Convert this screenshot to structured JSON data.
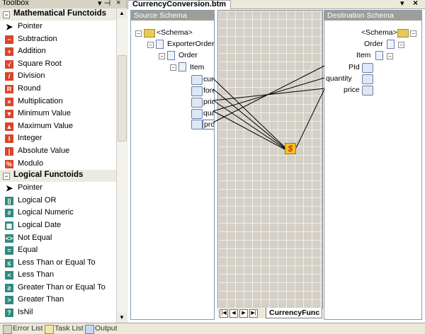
{
  "toolbox": {
    "title": "Toolbox",
    "controls": {
      "pin": "▾ ⊣",
      "close": "×"
    },
    "categories": [
      {
        "label": "Mathematical Functoids",
        "expander": "−",
        "items": [
          {
            "label": "Pointer",
            "icon": "pointer-icon",
            "glyph": "➤"
          },
          {
            "label": "Subtraction",
            "icon": "subtraction-icon",
            "glyph": "−"
          },
          {
            "label": "Addition",
            "icon": "addition-icon",
            "glyph": "+"
          },
          {
            "label": "Square Root",
            "icon": "square-root-icon",
            "glyph": "√"
          },
          {
            "label": "Division",
            "icon": "division-icon",
            "glyph": "/"
          },
          {
            "label": "Round",
            "icon": "round-icon",
            "glyph": "R"
          },
          {
            "label": "Multiplication",
            "icon": "multiplication-icon",
            "glyph": "×"
          },
          {
            "label": "Minimum Value",
            "icon": "minimum-value-icon",
            "glyph": "▼"
          },
          {
            "label": "Maximum Value",
            "icon": "maximum-value-icon",
            "glyph": "▲"
          },
          {
            "label": "Integer",
            "icon": "integer-icon",
            "glyph": "I"
          },
          {
            "label": "Absolute Value",
            "icon": "absolute-value-icon",
            "glyph": "|"
          },
          {
            "label": "Modulo",
            "icon": "modulo-icon",
            "glyph": "%"
          }
        ]
      },
      {
        "label": "Logical Functoids",
        "expander": "−",
        "items": [
          {
            "label": "Pointer",
            "icon": "pointer-icon",
            "glyph": "➤"
          },
          {
            "label": "Logical OR",
            "icon": "logical-or-icon",
            "glyph": "||"
          },
          {
            "label": "Logical Numeric",
            "icon": "logical-numeric-icon",
            "glyph": "#"
          },
          {
            "label": "Logical Date",
            "icon": "logical-date-icon",
            "glyph": "▦"
          },
          {
            "label": "Not Equal",
            "icon": "not-equal-icon",
            "glyph": "<>"
          },
          {
            "label": "Equal",
            "icon": "equal-icon",
            "glyph": "="
          },
          {
            "label": "Less Than or Equal To",
            "icon": "less-than-or-equal-icon",
            "glyph": "≤"
          },
          {
            "label": "Less Than",
            "icon": "less-than-icon",
            "glyph": "<"
          },
          {
            "label": "Greater Than or Equal To",
            "icon": "greater-than-or-equal-icon",
            "glyph": "≥"
          },
          {
            "label": "Greater Than",
            "icon": "greater-than-icon",
            "glyph": ">"
          },
          {
            "label": "IsNil",
            "icon": "isnil-icon",
            "glyph": "?"
          }
        ]
      }
    ]
  },
  "bottom_tabs": [
    {
      "label": "Error List",
      "icon": "error-list-icon"
    },
    {
      "label": "Task List",
      "icon": "task-list-icon"
    },
    {
      "label": "Output",
      "icon": "output-icon"
    }
  ],
  "document": {
    "tab_title": "CurrencyConversion.btm",
    "controls": {
      "dropdown": "▾",
      "close": "×"
    },
    "source": {
      "header": "Source Schema",
      "nodes": [
        "<Schema>",
        "ExporterOrder",
        "Order",
        "Item",
        "cur",
        "fore",
        "pric",
        "qua",
        "pro"
      ]
    },
    "destination": {
      "header": "Destination Schema",
      "nodes": [
        "<Schema>",
        "Order",
        "Item",
        "PId",
        "quantity",
        "price"
      ]
    },
    "grid_page_tab": "CurrencyFunc",
    "nav_buttons": [
      "|◀",
      "◀",
      "▶",
      "▶|"
    ],
    "functoid_glyph": "$"
  },
  "colors": {
    "functoid_bg": "#f4c21e",
    "header_bg": "#9e9d98",
    "math_icon": "#d9452a",
    "logic_icon": "#2f8a7d"
  }
}
